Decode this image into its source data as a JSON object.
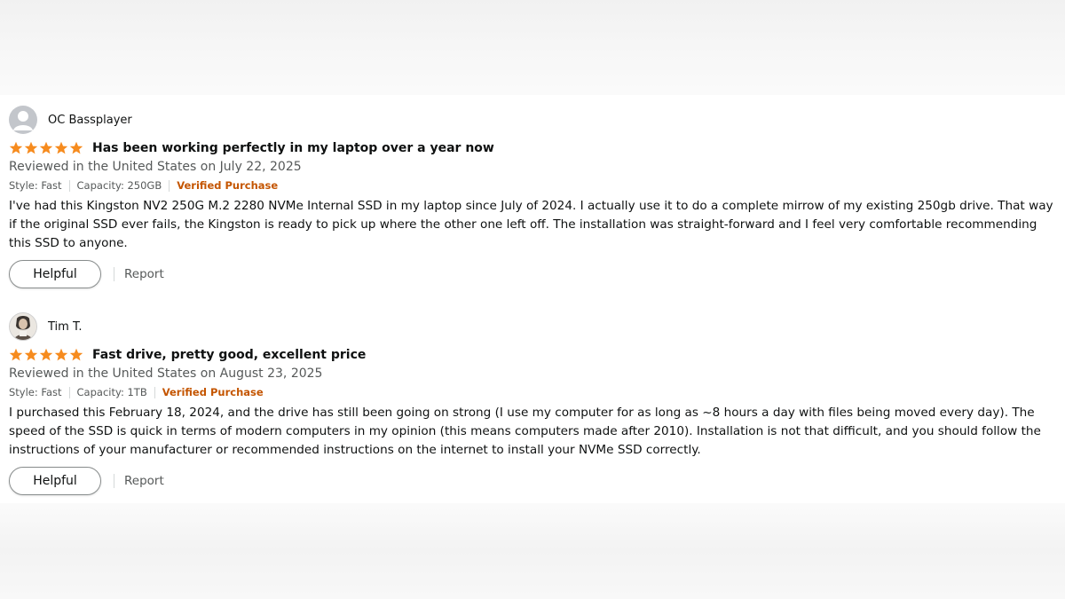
{
  "colors": {
    "star": "#f68b1e",
    "verified": "#c45500",
    "text": "#0f1111",
    "muted": "#565959"
  },
  "reviews": [
    {
      "profile_name": "OC Bassplayer",
      "avatar_icon": "default-user-avatar-icon",
      "rating": 5,
      "title": "Has been working perfectly in my laptop over a year now",
      "date": "Reviewed in the United States on July 22, 2025",
      "style": "Style: Fast",
      "capacity": "Capacity: 250GB",
      "verified": "Verified Purchase",
      "body": "I've had this Kingston NV2 250G M.2 2280 NVMe Internal SSD in my laptop since July of 2024. I actually use it to do a complete mirrow of my existing 250gb drive. That way if the original SSD ever fails, the Kingston is ready to pick up where the other one left off. The installation was straight-forward and I feel very comfortable recommending this SSD to anyone.",
      "helpful_label": "Helpful",
      "report_label": "Report"
    },
    {
      "profile_name": "Tim T.",
      "avatar_icon": "user-photo-avatar",
      "rating": 5,
      "title": "Fast drive, pretty good, excellent price",
      "date": "Reviewed in the United States on August 23, 2025",
      "style": "Style: Fast",
      "capacity": "Capacity: 1TB",
      "verified": "Verified Purchase",
      "body": "I purchased this February 18, 2024, and the drive has still been going on strong (I use my computer for as long as ~8 hours a day with files being moved every day). The speed of the SSD is quick in terms of modern computers in my opinion (this means computers made after 2010). Installation is not that difficult, and you should follow the instructions of your manufacturer or recommended instructions on the internet to install your NVMe SSD correctly.",
      "helpful_label": "Helpful",
      "report_label": "Report"
    }
  ]
}
